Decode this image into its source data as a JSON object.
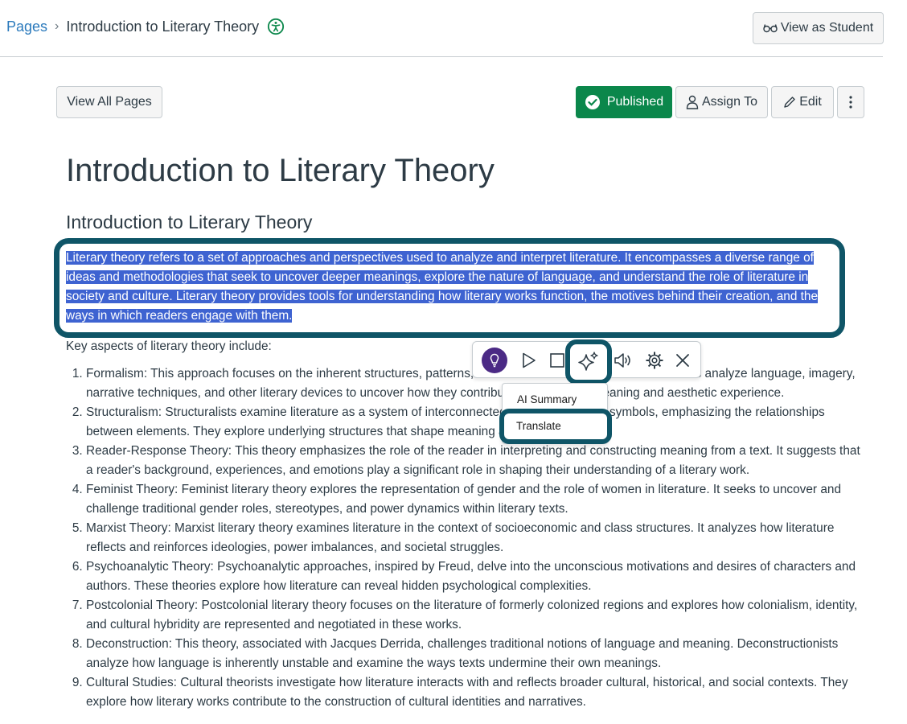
{
  "breadcrumb": {
    "root": "Pages",
    "current": "Introduction to Literary Theory"
  },
  "header": {
    "view_as_student": "View as Student"
  },
  "toolbar": {
    "view_all_pages": "View All Pages",
    "published": "Published",
    "assign_to": "Assign To",
    "edit": "Edit"
  },
  "page": {
    "title": "Introduction to Literary Theory",
    "heading": "Introduction to Literary Theory",
    "selected_paragraph": "Literary theory refers to a set of approaches and perspectives used to analyze and interpret literature. It encompasses a diverse range of ideas and methodologies that seek to uncover deeper meanings, explore the nature of language, and understand the role of literature in society and culture. Literary theory provides tools for understanding how literary works function, the motives behind their creation, and the ways in which readers engage with them.",
    "intro": "Key aspects of literary theory include:",
    "aspects": [
      "Formalism: This approach focuses on the inherent structures, patterns, and forms within literary texts. Formalists analyze language, imagery, narrative techniques, and other literary devices to uncover how they contribute to the overall meaning and aesthetic experience.",
      "Structuralism: Structuralists examine literature as a system of interconnected signs, codes, and symbols, emphasizing the relationships between elements. They explore underlying structures that shape meaning and communication.",
      "Reader-Response Theory: This theory emphasizes the role of the reader in interpreting and constructing meaning from a text. It suggests that a reader's background, experiences, and emotions play a significant role in shaping their understanding of a literary work.",
      "Feminist Theory: Feminist literary theory explores the representation of gender and the role of women in literature. It seeks to uncover and challenge traditional gender roles, stereotypes, and power dynamics within literary texts.",
      "Marxist Theory: Marxist literary theory examines literature in the context of socioeconomic and class structures. It analyzes how literature reflects and reinforces ideologies, power imbalances, and societal struggles.",
      "Psychoanalytic Theory: Psychoanalytic approaches, inspired by Freud, delve into the unconscious motivations and desires of characters and authors. These theories explore how literature can reveal hidden psychological complexities.",
      "Postcolonial Theory: Postcolonial literary theory focuses on the literature of formerly colonized regions and explores how colonialism, identity, and cultural hybridity are represented and negotiated in these works.",
      "Deconstruction: This theory, associated with Jacques Derrida, challenges traditional notions of language and meaning. Deconstructionists analyze how language is inherently unstable and examine the ways texts undermine their own meanings.",
      "Cultural Studies: Cultural theorists investigate how literature interacts with and reflects broader cultural, historical, and social contexts. They explore how literary works contribute to the construction of cultural identities and narratives."
    ]
  },
  "reader_toolbar": {
    "icons": [
      "lightbulb-icon",
      "play-icon",
      "stop-icon",
      "ai-sparkle-icon",
      "volume-icon",
      "gear-icon",
      "close-icon"
    ],
    "menu": {
      "ai_summary": "AI Summary",
      "translate": "Translate"
    }
  },
  "colors": {
    "link": "#2b7abc",
    "published_green": "#0b874b",
    "selection": "#3e63d1",
    "annotation_frame": "#0f5567",
    "text": "#2d3b45"
  }
}
